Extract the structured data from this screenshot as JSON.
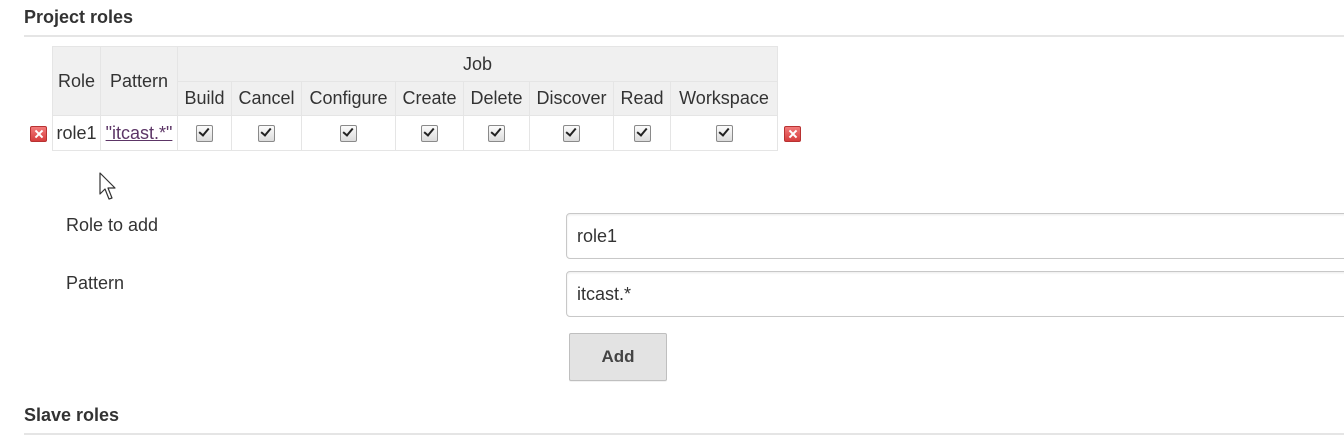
{
  "project_roles": {
    "title": "Project roles",
    "headers": {
      "role": "Role",
      "pattern": "Pattern",
      "group": "Job",
      "permissions": [
        "Build",
        "Cancel",
        "Configure",
        "Create",
        "Delete",
        "Discover",
        "Read",
        "Workspace"
      ]
    },
    "rows": [
      {
        "role": "role1",
        "pattern": "\"itcast.*\"",
        "checked": [
          true,
          true,
          true,
          true,
          true,
          true,
          true,
          true
        ]
      }
    ]
  },
  "form": {
    "role_label": "Role to add",
    "role_value": "role1",
    "pattern_label": "Pattern",
    "pattern_value": "itcast.*",
    "add_label": "Add"
  },
  "slave_roles": {
    "title": "Slave roles"
  },
  "colors": {
    "header_bg": "#f0f0f0",
    "border": "#e5e5e5",
    "delete_icon": "#d63d3d",
    "link": "#5c3566"
  }
}
